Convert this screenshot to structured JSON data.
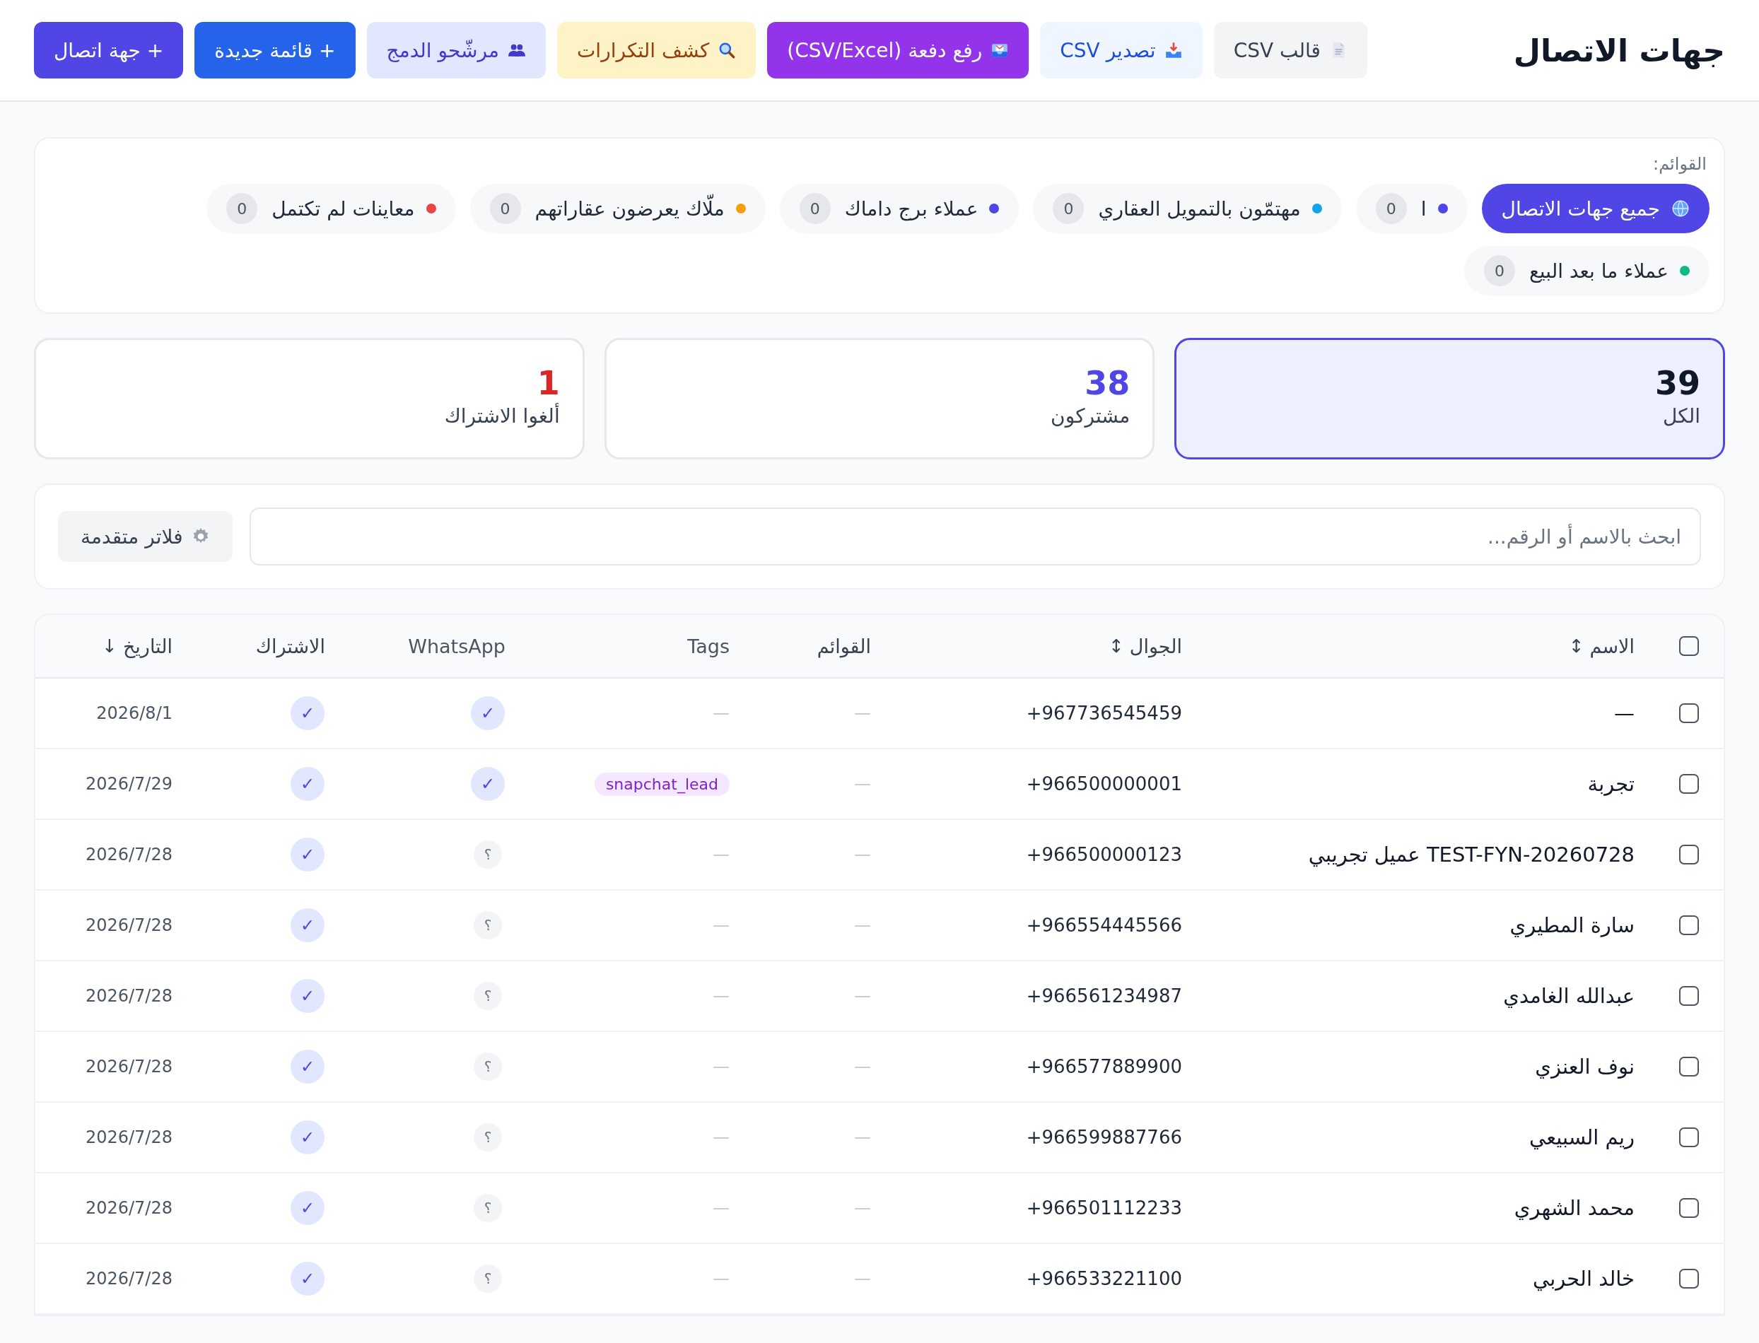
{
  "header": {
    "title": "جهات الاتصال",
    "buttons": [
      {
        "label": "قالب CSV",
        "kind": "template"
      },
      {
        "label": "تصدير CSV",
        "kind": "export"
      },
      {
        "label": "رفع دفعة (CSV/Excel)",
        "kind": "upload"
      },
      {
        "label": "كشف التكرارات",
        "kind": "dedupe"
      },
      {
        "label": "مرشّحو الدمج",
        "kind": "merge"
      },
      {
        "label": "+ قائمة جديدة",
        "kind": "list"
      },
      {
        "label": "+ جهة اتصال",
        "kind": "contact"
      }
    ]
  },
  "lists": {
    "label": "القوائم:",
    "items": [
      {
        "label": "جميع جهات الاتصال",
        "kind": "all",
        "selected": true
      },
      {
        "label": "ا",
        "count": "0",
        "color": "#4f46e5",
        "selected": false
      },
      {
        "label": "مهتمّون بالتمويل العقاري",
        "count": "0",
        "color": "#0ea5e9",
        "selected": false
      },
      {
        "label": "عملاء برج داماك",
        "count": "0",
        "color": "#4f46e5",
        "selected": false
      },
      {
        "label": "ملّاك يعرضون عقاراتهم",
        "count": "0",
        "color": "#f59e0b",
        "selected": false
      },
      {
        "label": "معاينات لم تكتمل",
        "count": "0",
        "color": "#ef4444",
        "selected": false
      },
      {
        "label": "عملاء ما بعد البيع",
        "count": "0",
        "color": "#10b981",
        "selected": false
      }
    ]
  },
  "stats": [
    {
      "value": "39",
      "label": "الكل",
      "color": "#111827",
      "selected": true
    },
    {
      "value": "38",
      "label": "مشتركون",
      "color": "#4f46e5",
      "selected": false
    },
    {
      "value": "1",
      "label": "ألغوا الاشتراك",
      "color": "#dc2626",
      "selected": false
    }
  ],
  "search": {
    "placeholder": "ابحث بالاسم أو الرقم...",
    "filter_button": "فلاتر متقدمة"
  },
  "table": {
    "select_all": {
      "checked": false
    },
    "columns": [
      {
        "label": "الاسم",
        "sort": "↕"
      },
      {
        "label": "الجوال",
        "sort": "↕"
      },
      {
        "label": "القوائم"
      },
      {
        "label": "Tags"
      },
      {
        "label": "WhatsApp"
      },
      {
        "label": "الاشتراك"
      },
      {
        "label": "التاريخ",
        "sort": "↓"
      }
    ],
    "rows": [
      {
        "checked": false,
        "name": "—",
        "phone": "+967736545459",
        "lists": "—",
        "tags": [
          {
            "label": "—",
            "kind": "empty"
          }
        ],
        "whatsapp": {
          "mark": "✓",
          "kind": "yes"
        },
        "subscription": "✓",
        "date": "2026/8/1"
      },
      {
        "checked": false,
        "name": "تجربة",
        "phone": "+966500000001",
        "lists": "—",
        "tags": [
          {
            "label": "snapchat_lead",
            "kind": "chip"
          }
        ],
        "whatsapp": {
          "mark": "✓",
          "kind": "yes"
        },
        "subscription": "✓",
        "date": "2026/7/29"
      },
      {
        "checked": false,
        "name": "TEST-FYN-20260728 عميل تجريبي",
        "phone": "+966500000123",
        "lists": "—",
        "tags": [
          {
            "label": "—",
            "kind": "empty"
          }
        ],
        "whatsapp": {
          "mark": "؟",
          "kind": "unknown"
        },
        "subscription": "✓",
        "date": "2026/7/28"
      },
      {
        "checked": false,
        "name": "سارة المطيري",
        "phone": "+966554445566",
        "lists": "—",
        "tags": [
          {
            "label": "—",
            "kind": "empty"
          }
        ],
        "whatsapp": {
          "mark": "؟",
          "kind": "unknown"
        },
        "subscription": "✓",
        "date": "2026/7/28"
      },
      {
        "checked": false,
        "name": "عبدالله الغامدي",
        "phone": "+966561234987",
        "lists": "—",
        "tags": [
          {
            "label": "—",
            "kind": "empty"
          }
        ],
        "whatsapp": {
          "mark": "؟",
          "kind": "unknown"
        },
        "subscription": "✓",
        "date": "2026/7/28"
      },
      {
        "checked": false,
        "name": "نوف العنزي",
        "phone": "+966577889900",
        "lists": "—",
        "tags": [
          {
            "label": "—",
            "kind": "empty"
          }
        ],
        "whatsapp": {
          "mark": "؟",
          "kind": "unknown"
        },
        "subscription": "✓",
        "date": "2026/7/28"
      },
      {
        "checked": false,
        "name": "ريم السبيعي",
        "phone": "+966599887766",
        "lists": "—",
        "tags": [
          {
            "label": "—",
            "kind": "empty"
          }
        ],
        "whatsapp": {
          "mark": "؟",
          "kind": "unknown"
        },
        "subscription": "✓",
        "date": "2026/7/28"
      },
      {
        "checked": false,
        "name": "محمد الشهري",
        "phone": "+966501112233",
        "lists": "—",
        "tags": [
          {
            "label": "—",
            "kind": "empty"
          }
        ],
        "whatsapp": {
          "mark": "؟",
          "kind": "unknown"
        },
        "subscription": "✓",
        "date": "2026/7/28"
      },
      {
        "checked": false,
        "name": "خالد الحربي",
        "phone": "+966533221100",
        "lists": "—",
        "tags": [
          {
            "label": "—",
            "kind": "empty"
          }
        ],
        "whatsapp": {
          "mark": "؟",
          "kind": "unknown"
        },
        "subscription": "✓",
        "date": "2026/7/28"
      }
    ]
  }
}
